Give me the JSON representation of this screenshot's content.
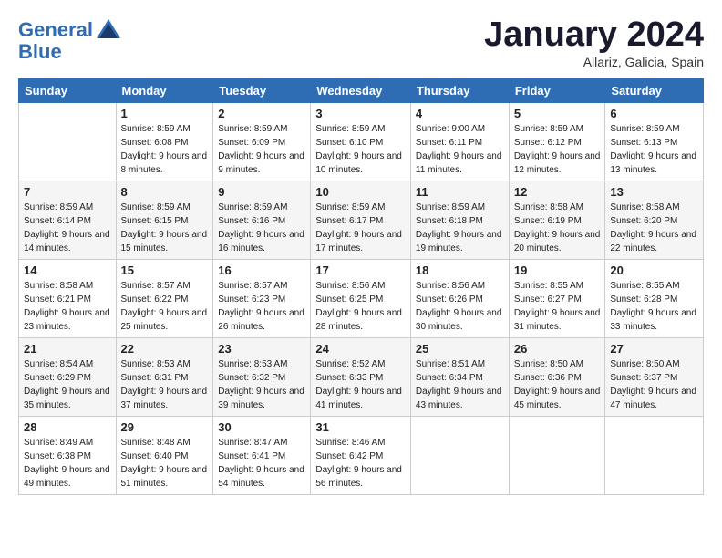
{
  "header": {
    "logo_line1": "General",
    "logo_line2": "Blue",
    "month": "January 2024",
    "location": "Allariz, Galicia, Spain"
  },
  "columns": [
    "Sunday",
    "Monday",
    "Tuesday",
    "Wednesday",
    "Thursday",
    "Friday",
    "Saturday"
  ],
  "weeks": [
    [
      {
        "num": "",
        "sunrise": "",
        "sunset": "",
        "daylight": ""
      },
      {
        "num": "1",
        "sunrise": "Sunrise: 8:59 AM",
        "sunset": "Sunset: 6:08 PM",
        "daylight": "Daylight: 9 hours and 8 minutes."
      },
      {
        "num": "2",
        "sunrise": "Sunrise: 8:59 AM",
        "sunset": "Sunset: 6:09 PM",
        "daylight": "Daylight: 9 hours and 9 minutes."
      },
      {
        "num": "3",
        "sunrise": "Sunrise: 8:59 AM",
        "sunset": "Sunset: 6:10 PM",
        "daylight": "Daylight: 9 hours and 10 minutes."
      },
      {
        "num": "4",
        "sunrise": "Sunrise: 9:00 AM",
        "sunset": "Sunset: 6:11 PM",
        "daylight": "Daylight: 9 hours and 11 minutes."
      },
      {
        "num": "5",
        "sunrise": "Sunrise: 8:59 AM",
        "sunset": "Sunset: 6:12 PM",
        "daylight": "Daylight: 9 hours and 12 minutes."
      },
      {
        "num": "6",
        "sunrise": "Sunrise: 8:59 AM",
        "sunset": "Sunset: 6:13 PM",
        "daylight": "Daylight: 9 hours and 13 minutes."
      }
    ],
    [
      {
        "num": "7",
        "sunrise": "Sunrise: 8:59 AM",
        "sunset": "Sunset: 6:14 PM",
        "daylight": "Daylight: 9 hours and 14 minutes."
      },
      {
        "num": "8",
        "sunrise": "Sunrise: 8:59 AM",
        "sunset": "Sunset: 6:15 PM",
        "daylight": "Daylight: 9 hours and 15 minutes."
      },
      {
        "num": "9",
        "sunrise": "Sunrise: 8:59 AM",
        "sunset": "Sunset: 6:16 PM",
        "daylight": "Daylight: 9 hours and 16 minutes."
      },
      {
        "num": "10",
        "sunrise": "Sunrise: 8:59 AM",
        "sunset": "Sunset: 6:17 PM",
        "daylight": "Daylight: 9 hours and 17 minutes."
      },
      {
        "num": "11",
        "sunrise": "Sunrise: 8:59 AM",
        "sunset": "Sunset: 6:18 PM",
        "daylight": "Daylight: 9 hours and 19 minutes."
      },
      {
        "num": "12",
        "sunrise": "Sunrise: 8:58 AM",
        "sunset": "Sunset: 6:19 PM",
        "daylight": "Daylight: 9 hours and 20 minutes."
      },
      {
        "num": "13",
        "sunrise": "Sunrise: 8:58 AM",
        "sunset": "Sunset: 6:20 PM",
        "daylight": "Daylight: 9 hours and 22 minutes."
      }
    ],
    [
      {
        "num": "14",
        "sunrise": "Sunrise: 8:58 AM",
        "sunset": "Sunset: 6:21 PM",
        "daylight": "Daylight: 9 hours and 23 minutes."
      },
      {
        "num": "15",
        "sunrise": "Sunrise: 8:57 AM",
        "sunset": "Sunset: 6:22 PM",
        "daylight": "Daylight: 9 hours and 25 minutes."
      },
      {
        "num": "16",
        "sunrise": "Sunrise: 8:57 AM",
        "sunset": "Sunset: 6:23 PM",
        "daylight": "Daylight: 9 hours and 26 minutes."
      },
      {
        "num": "17",
        "sunrise": "Sunrise: 8:56 AM",
        "sunset": "Sunset: 6:25 PM",
        "daylight": "Daylight: 9 hours and 28 minutes."
      },
      {
        "num": "18",
        "sunrise": "Sunrise: 8:56 AM",
        "sunset": "Sunset: 6:26 PM",
        "daylight": "Daylight: 9 hours and 30 minutes."
      },
      {
        "num": "19",
        "sunrise": "Sunrise: 8:55 AM",
        "sunset": "Sunset: 6:27 PM",
        "daylight": "Daylight: 9 hours and 31 minutes."
      },
      {
        "num": "20",
        "sunrise": "Sunrise: 8:55 AM",
        "sunset": "Sunset: 6:28 PM",
        "daylight": "Daylight: 9 hours and 33 minutes."
      }
    ],
    [
      {
        "num": "21",
        "sunrise": "Sunrise: 8:54 AM",
        "sunset": "Sunset: 6:29 PM",
        "daylight": "Daylight: 9 hours and 35 minutes."
      },
      {
        "num": "22",
        "sunrise": "Sunrise: 8:53 AM",
        "sunset": "Sunset: 6:31 PM",
        "daylight": "Daylight: 9 hours and 37 minutes."
      },
      {
        "num": "23",
        "sunrise": "Sunrise: 8:53 AM",
        "sunset": "Sunset: 6:32 PM",
        "daylight": "Daylight: 9 hours and 39 minutes."
      },
      {
        "num": "24",
        "sunrise": "Sunrise: 8:52 AM",
        "sunset": "Sunset: 6:33 PM",
        "daylight": "Daylight: 9 hours and 41 minutes."
      },
      {
        "num": "25",
        "sunrise": "Sunrise: 8:51 AM",
        "sunset": "Sunset: 6:34 PM",
        "daylight": "Daylight: 9 hours and 43 minutes."
      },
      {
        "num": "26",
        "sunrise": "Sunrise: 8:50 AM",
        "sunset": "Sunset: 6:36 PM",
        "daylight": "Daylight: 9 hours and 45 minutes."
      },
      {
        "num": "27",
        "sunrise": "Sunrise: 8:50 AM",
        "sunset": "Sunset: 6:37 PM",
        "daylight": "Daylight: 9 hours and 47 minutes."
      }
    ],
    [
      {
        "num": "28",
        "sunrise": "Sunrise: 8:49 AM",
        "sunset": "Sunset: 6:38 PM",
        "daylight": "Daylight: 9 hours and 49 minutes."
      },
      {
        "num": "29",
        "sunrise": "Sunrise: 8:48 AM",
        "sunset": "Sunset: 6:40 PM",
        "daylight": "Daylight: 9 hours and 51 minutes."
      },
      {
        "num": "30",
        "sunrise": "Sunrise: 8:47 AM",
        "sunset": "Sunset: 6:41 PM",
        "daylight": "Daylight: 9 hours and 54 minutes."
      },
      {
        "num": "31",
        "sunrise": "Sunrise: 8:46 AM",
        "sunset": "Sunset: 6:42 PM",
        "daylight": "Daylight: 9 hours and 56 minutes."
      },
      {
        "num": "",
        "sunrise": "",
        "sunset": "",
        "daylight": ""
      },
      {
        "num": "",
        "sunrise": "",
        "sunset": "",
        "daylight": ""
      },
      {
        "num": "",
        "sunrise": "",
        "sunset": "",
        "daylight": ""
      }
    ]
  ]
}
